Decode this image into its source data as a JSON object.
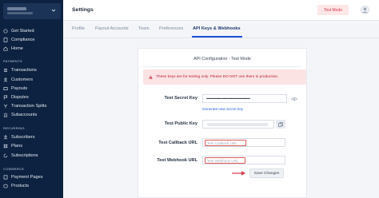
{
  "header": {
    "title": "Settings",
    "mode_badge": "Test Mode"
  },
  "sidebar": {
    "items_top": [
      {
        "label": "Get Started",
        "icon": "rocket-icon"
      },
      {
        "label": "Compliance",
        "icon": "document-icon"
      },
      {
        "label": "Home",
        "icon": "home-icon"
      }
    ],
    "section_payments": "PAYMENTS",
    "items_payments": [
      {
        "label": "Transactions",
        "icon": "list-icon"
      },
      {
        "label": "Customers",
        "icon": "users-icon"
      },
      {
        "label": "Payouts",
        "icon": "wallet-icon"
      },
      {
        "label": "Disputes",
        "icon": "flag-icon"
      },
      {
        "label": "Transaction Splits",
        "icon": "split-icon"
      },
      {
        "label": "Subaccounts",
        "icon": "bank-icon"
      }
    ],
    "section_recurring": "RECURRING",
    "items_recurring": [
      {
        "label": "Subscribers",
        "icon": "users-icon"
      },
      {
        "label": "Plans",
        "icon": "grid-icon"
      },
      {
        "label": "Subscriptions",
        "icon": "refresh-icon"
      }
    ],
    "section_commerce": "COMMERCE",
    "items_commerce": [
      {
        "label": "Payment Pages",
        "icon": "page-icon"
      },
      {
        "label": "Products",
        "icon": "box-icon"
      }
    ]
  },
  "tabs": [
    "Profile",
    "Payout Accounts",
    "Team",
    "Preferences",
    "API Keys & Webhooks"
  ],
  "card": {
    "title": "API Configuration - Test Mode",
    "alert": "These keys are for testing only. Please DO NOT use them in production.",
    "secret_key_label": "Test Secret Key",
    "secret_key_value": "••••••••••••••••••••••••••••••••••••••••••••••••",
    "generate_link": "Generate new secret key",
    "public_key_label": "Test Public Key",
    "callback_label": "Test Callback URL",
    "callback_placeholder": "Test Callback URL",
    "webhook_label": "Test Webhook URL",
    "webhook_placeholder": "Test Webhook URL",
    "save_label": "Save Changes"
  },
  "colors": {
    "sidebar": "#0d2240",
    "accent": "#1d4ed8",
    "alert_bg": "#fbe3e4",
    "alert_text": "#b42335",
    "highlight": "#e15a5a"
  }
}
